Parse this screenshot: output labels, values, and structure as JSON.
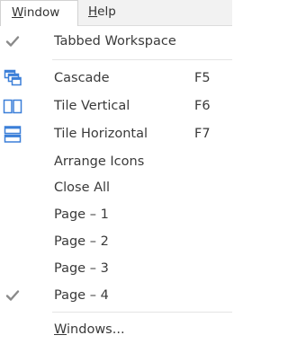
{
  "menubar": {
    "window": {
      "mnemonic": "W",
      "rest": "indow"
    },
    "help": {
      "mnemonic": "H",
      "rest": "elp"
    }
  },
  "menu": {
    "tabbed": {
      "label": "Tabbed Workspace",
      "checked": true,
      "icon": "checkmark-icon"
    },
    "cascade": {
      "label": "Cascade",
      "shortcut": "F5",
      "icon": "cascade-windows-icon"
    },
    "tile_vertical": {
      "label": "Tile Vertical",
      "shortcut": "F6",
      "icon": "tile-vertical-icon"
    },
    "tile_horizontal": {
      "label": "Tile Horizontal",
      "shortcut": "F7",
      "icon": "tile-horizontal-icon"
    },
    "arrange_icons": {
      "label": "Arrange Icons"
    },
    "close_all": {
      "label": "Close All"
    },
    "pages": [
      {
        "label": "Page – 1",
        "checked": false
      },
      {
        "label": "Page – 2",
        "checked": false
      },
      {
        "label": "Page – 3",
        "checked": false
      },
      {
        "label": "Page – 4",
        "checked": true
      }
    ],
    "windows": {
      "mnemonic": "W",
      "rest": "indows..."
    }
  },
  "colors": {
    "icon_blue": "#3b7fd8",
    "checkmark": "#8a8a8a"
  }
}
